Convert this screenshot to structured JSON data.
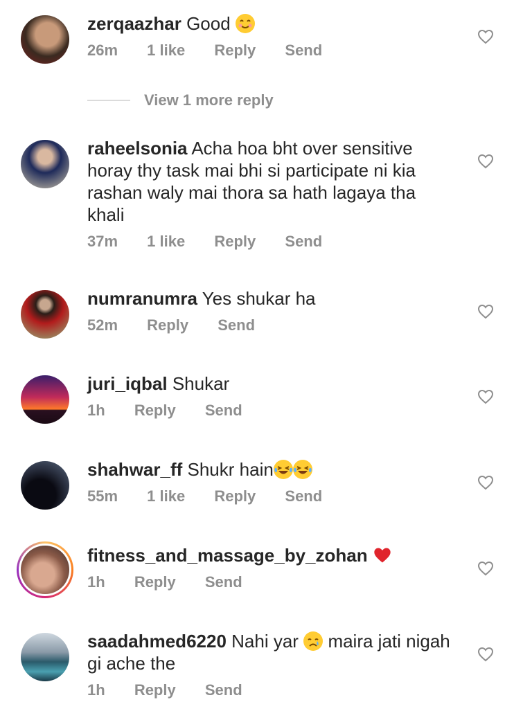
{
  "comments": [
    {
      "user": "zerqaazhar",
      "text": "Good",
      "emoji": "smile",
      "time": "26m",
      "likes": "1 like",
      "reply": "Reply",
      "send": "Send"
    },
    {
      "user": "raheelsonia",
      "text": "Acha hoa bht over sensitive horay thy task mai bhi si participate ni kia rashan waly mai thora sa hath lagaya tha khali",
      "emoji": "",
      "time": "37m",
      "likes": "1 like",
      "reply": "Reply",
      "send": "Send"
    },
    {
      "user": "numranumra",
      "text": "Yes shukar ha",
      "emoji": "",
      "time": "52m",
      "likes": "",
      "reply": "Reply",
      "send": "Send"
    },
    {
      "user": "juri_iqbal",
      "text": "Shukar",
      "emoji": "",
      "time": "1h",
      "likes": "",
      "reply": "Reply",
      "send": "Send"
    },
    {
      "user": "shahwar_ff",
      "text": "Shukr hain",
      "emoji": "laugh2",
      "time": "55m",
      "likes": "1 like",
      "reply": "Reply",
      "send": "Send"
    },
    {
      "user": "fitness_and_massage_by_zohan",
      "text": "",
      "emoji": "heart",
      "time": "1h",
      "likes": "",
      "reply": "Reply",
      "send": "Send"
    },
    {
      "user": "saadahmed6220",
      "text_before": "Nahi yar",
      "text": "maira jati nigah gi ache the",
      "emoji": "cry",
      "time": "1h",
      "likes": "",
      "reply": "Reply",
      "send": "Send"
    }
  ],
  "view_more": "View 1 more reply",
  "colors": {
    "text": "#262626",
    "meta": "#8e8e8e",
    "heart_red": "#ed4956",
    "story_ring": "#c13584"
  }
}
